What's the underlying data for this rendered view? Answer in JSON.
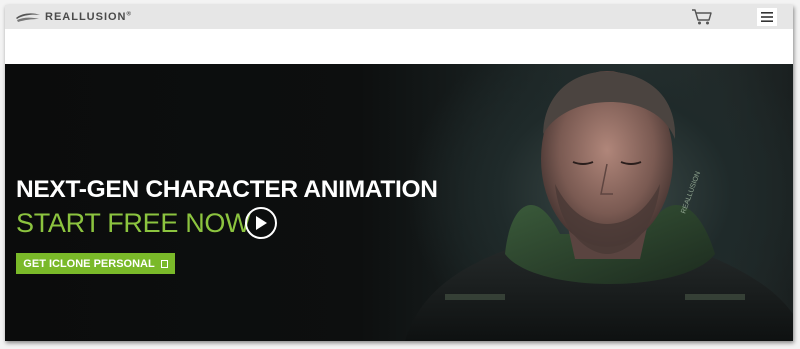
{
  "header": {
    "brand": "REALLUSION",
    "brand_mark": "®",
    "cart_icon": "cart-icon",
    "menu_icon": "hamburger-menu-icon"
  },
  "hero": {
    "headline": "NEXT-GEN CHARACTER ANIMATION",
    "subheadline": "START FREE NOW",
    "play_icon": "play-icon",
    "cta_label": "GET ICLONE PERSONAL",
    "cta_icon": "external-link-icon",
    "image": "man-in-green-hoodie-eyes-closed",
    "colors": {
      "accent_green": "#8cc43f",
      "button_green": "#7ab929",
      "hero_bg": "#0c0e0e"
    }
  }
}
